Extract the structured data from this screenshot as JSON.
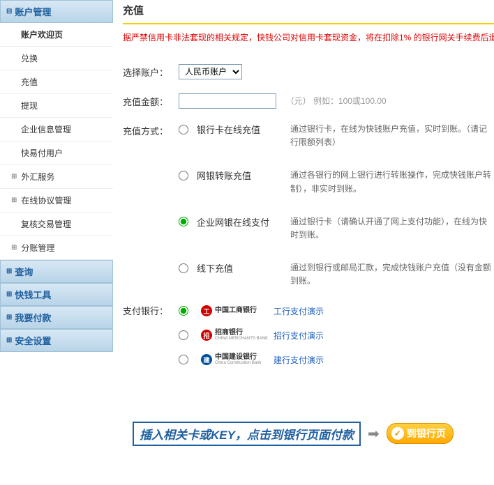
{
  "sidebar": {
    "sections": [
      {
        "label": "账户管理",
        "expanded": true,
        "items": [
          {
            "label": "账户欢迎页",
            "active": true,
            "hasChildren": false
          },
          {
            "label": "兑换",
            "active": false,
            "hasChildren": false
          },
          {
            "label": "充值",
            "active": false,
            "hasChildren": false
          },
          {
            "label": "提现",
            "active": false,
            "hasChildren": false
          },
          {
            "label": "企业信息管理",
            "active": false,
            "hasChildren": false
          },
          {
            "label": "快易付用户",
            "active": false,
            "hasChildren": false
          },
          {
            "label": "外汇服务",
            "active": false,
            "hasChildren": true
          },
          {
            "label": "在线协议管理",
            "active": false,
            "hasChildren": true
          },
          {
            "label": "复核交易管理",
            "active": false,
            "hasChildren": false
          },
          {
            "label": "分账管理",
            "active": false,
            "hasChildren": true
          }
        ]
      },
      {
        "label": "查询",
        "expanded": false
      },
      {
        "label": "快钱工具",
        "expanded": false
      },
      {
        "label": "我要付款",
        "expanded": false
      },
      {
        "label": "安全设置",
        "expanded": false
      }
    ]
  },
  "main": {
    "title": "充值",
    "warning": "据严禁信用卡非法套现的相关规定，快钱公司对信用卡套现资金，将在扣除1% 的银行网关手续费后退",
    "form": {
      "account_label": "选择账户：",
      "account_value": "人民币账户",
      "amount_label": "充值金额：",
      "amount_value": "",
      "amount_hint": "（元） 例如：100或100.00",
      "method_label": "充值方式：",
      "methods": [
        {
          "label": "银行卡在线充值",
          "desc": "通过银行卡，在线为快钱账户充值，实时到账。（请记行限额列表）",
          "checked": false
        },
        {
          "label": "网银转账充值",
          "desc": "通过各银行的网上银行进行转账操作，完成快钱账户转制），非实时到账。",
          "checked": false
        },
        {
          "label": "企业网银在线支付",
          "desc": "通过银行卡（请确认开通了网上支付功能），在线为快时到账。",
          "checked": true
        },
        {
          "label": "线下充值",
          "desc": "通过到银行或邮局汇款，完成快钱账户充值（没有金额到账。",
          "checked": false
        }
      ],
      "bank_label": "支付银行：",
      "banks": [
        {
          "name_cn": "中国工商银行",
          "name_en": "",
          "link": "工行支付演示",
          "color": "#d00000",
          "checked": true
        },
        {
          "name_cn": "招商银行",
          "name_en": "CHINA MERCHANTS BANK",
          "link": "招行支付演示",
          "color": "#d00000",
          "checked": false
        },
        {
          "name_cn": "中国建设银行",
          "name_en": "China Construction Bank",
          "link": "建行支付演示",
          "color": "#0050a0",
          "checked": false
        }
      ]
    },
    "bottom": {
      "instruction": "插入相关卡或KEY，点击到银行页面付款",
      "button": "到银行页"
    }
  }
}
